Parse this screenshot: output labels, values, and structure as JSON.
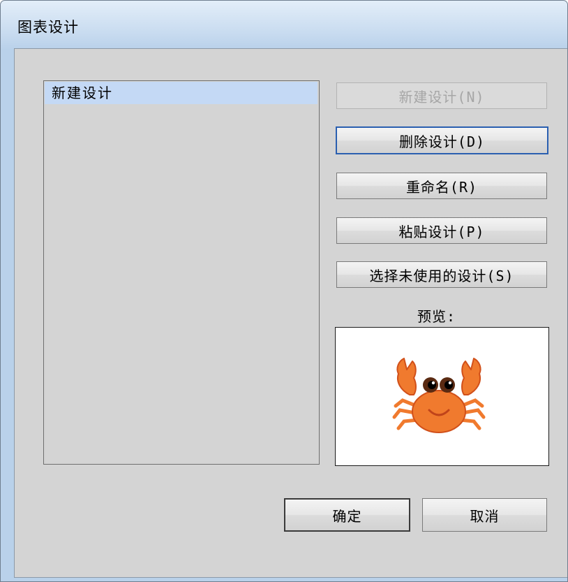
{
  "window": {
    "title": "图表设计"
  },
  "design_list": {
    "items": [
      "新建设计"
    ],
    "selected_index": 0
  },
  "buttons": {
    "new_design": "新建设计(N)",
    "delete_design": "删除设计(D)",
    "rename": "重命名(R)",
    "paste_design": "粘贴设计(P)",
    "select_unused": "选择未使用的设计(S)",
    "ok": "确定",
    "cancel": "取消"
  },
  "preview": {
    "label": "预览:",
    "image_icon": "crab-icon"
  },
  "colors": {
    "selection": "#c4d9f5",
    "dialog_bg": "#d4d4d4",
    "crab": "#f07a2e"
  }
}
